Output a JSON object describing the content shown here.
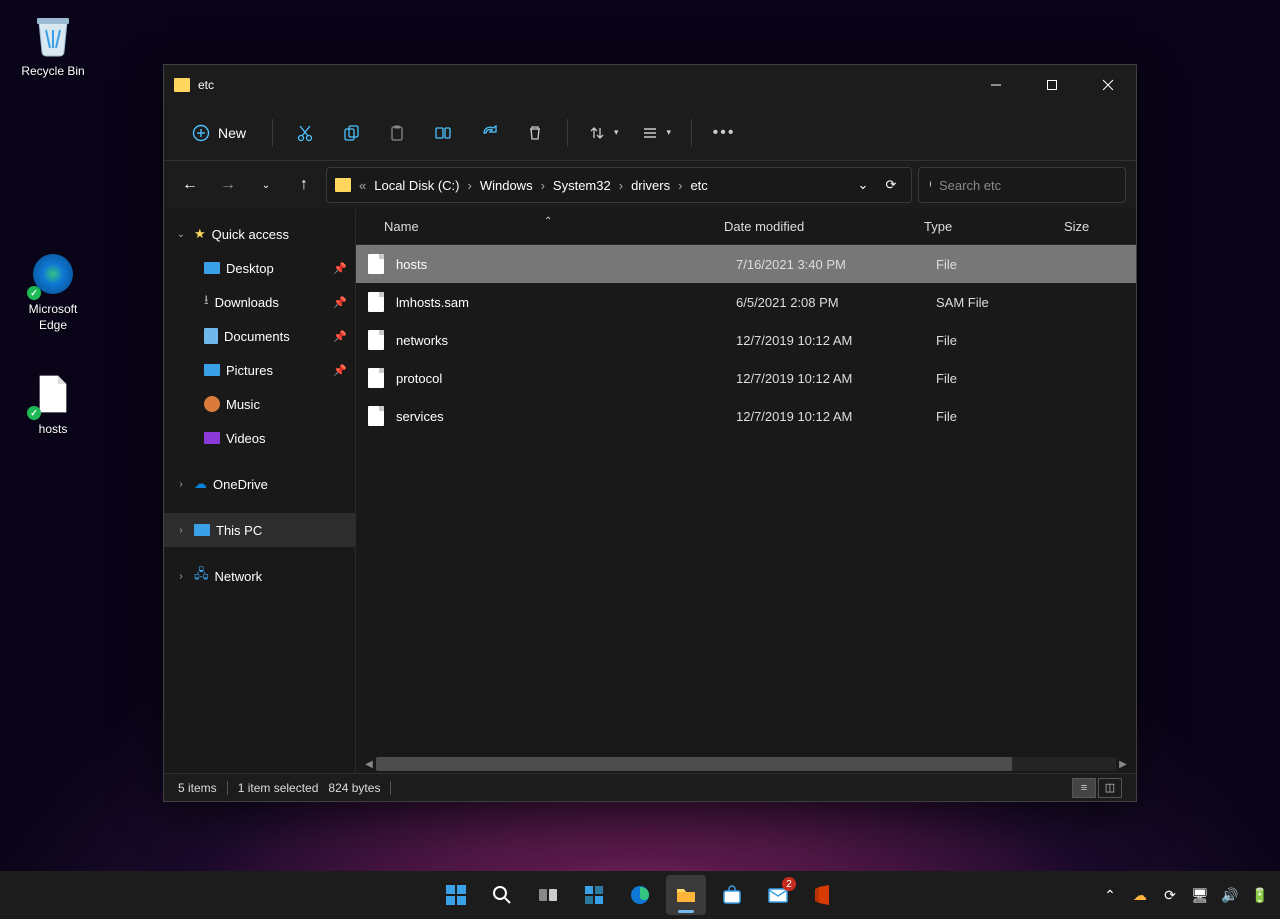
{
  "desktop": {
    "icons": [
      {
        "name": "Recycle Bin"
      },
      {
        "name": "Microsoft Edge"
      },
      {
        "name": "hosts"
      }
    ]
  },
  "window": {
    "title": "etc",
    "toolbar": {
      "new_label": "New"
    },
    "breadcrumb": {
      "prefix": "«",
      "segments": [
        "Local Disk (C:)",
        "Windows",
        "System32",
        "drivers",
        "etc"
      ]
    },
    "search_placeholder": "Search etc",
    "sidebar": {
      "quick_access": "Quick access",
      "items": [
        "Desktop",
        "Downloads",
        "Documents",
        "Pictures",
        "Music",
        "Videos"
      ],
      "onedrive": "OneDrive",
      "thispc": "This PC",
      "network": "Network"
    },
    "columns": {
      "name": "Name",
      "date": "Date modified",
      "type": "Type",
      "size": "Size"
    },
    "files": [
      {
        "name": "hosts",
        "date": "7/16/2021 3:40 PM",
        "type": "File",
        "selected": true
      },
      {
        "name": "lmhosts.sam",
        "date": "6/5/2021 2:08 PM",
        "type": "SAM File",
        "selected": false
      },
      {
        "name": "networks",
        "date": "12/7/2019 10:12 AM",
        "type": "File",
        "selected": false
      },
      {
        "name": "protocol",
        "date": "12/7/2019 10:12 AM",
        "type": "File",
        "selected": false
      },
      {
        "name": "services",
        "date": "12/7/2019 10:12 AM",
        "type": "File",
        "selected": false
      }
    ],
    "status": {
      "count": "5 items",
      "selection": "1 item selected",
      "bytes": "824 bytes"
    }
  },
  "taskbar": {
    "mail_badge": "2"
  }
}
